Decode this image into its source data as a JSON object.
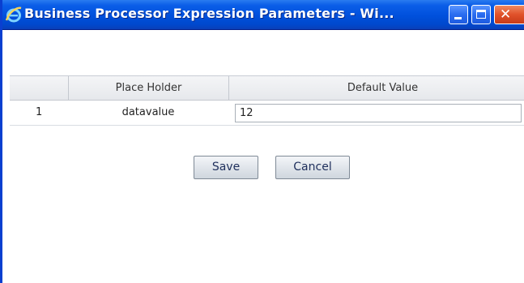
{
  "window": {
    "title": "Business Processor Expression Parameters - Wi...",
    "app_icon": "internet-explorer-icon",
    "controls": [
      "minimize-icon",
      "maximize-icon",
      "close-icon"
    ]
  },
  "grid": {
    "columns": [
      "",
      "Place Holder",
      "Default Value"
    ],
    "rows": [
      {
        "index": "1",
        "place_holder": "datavalue",
        "default_value": "12"
      }
    ]
  },
  "actions": {
    "save_label": "Save",
    "cancel_label": "Cancel"
  },
  "colors": {
    "titlebar": "#0050dc",
    "close_button": "#e0512a",
    "grid_header": "#e6e8ec"
  }
}
